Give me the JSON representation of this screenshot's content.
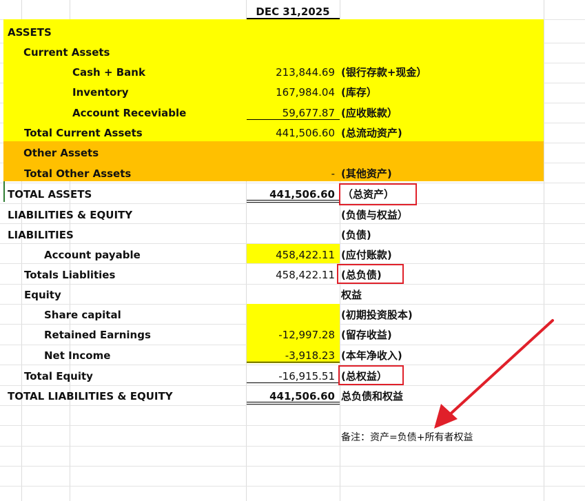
{
  "header": {
    "date": "DEC 31,2025"
  },
  "rows": {
    "assets": {
      "label": "ASSETS"
    },
    "current_assets": {
      "label": "Current Assets"
    },
    "cash_bank": {
      "label": "Cash + Bank",
      "value": "213,844.69",
      "note": "(银行存款+现金）"
    },
    "inventory": {
      "label": "Inventory",
      "value": "167,984.04",
      "note": "(库存）"
    },
    "account_receivable": {
      "label": "Account Receviable",
      "value": "59,677.87",
      "note": "(应收账款）"
    },
    "total_current_assets": {
      "label": "Total Current Assets",
      "value": "441,506.60",
      "note": "(总流动资产)"
    },
    "other_assets": {
      "label": "Other Assets"
    },
    "total_other_assets": {
      "label": "Total Other Assets",
      "value": "-",
      "note": "(其他资产)"
    },
    "total_assets": {
      "label": "TOTAL ASSETS",
      "value": "441,506.60",
      "note": "（总资产）"
    },
    "liabilities_equity": {
      "label": "LIABILITIES & EQUITY",
      "note": "(负债与权益）"
    },
    "liabilities": {
      "label": "LIABILITIES",
      "note": "(负债)"
    },
    "account_payable": {
      "label": "Account payable",
      "value": "458,422.11",
      "note": "(应付账款)"
    },
    "total_liabilities": {
      "label": "Totals Liablities",
      "value": "458,422.11",
      "note": "(总负债)"
    },
    "equity": {
      "label": "Equity",
      "note": "权益"
    },
    "share_capital": {
      "label": "Share capital",
      "note": "(初期投资股本)"
    },
    "retained_earnings": {
      "label": "Retained Earnings",
      "value": "-12,997.28",
      "note": "(留存收益)"
    },
    "net_income": {
      "label": "Net Income",
      "value": "-3,918.23",
      "note": "(本年净收入)"
    },
    "total_equity": {
      "label": "Total Equity",
      "value": "-16,915.51",
      "note": "(总权益）"
    },
    "total_liabilities_equity": {
      "label": "TOTAL LIABILITIES & EQUITY",
      "value": "441,506.60",
      "note": "总负债和权益"
    }
  },
  "remark": "备注：资产=负债+所有者权益",
  "colors": {
    "yellow": "#ffff00",
    "orange": "#ffc000",
    "red_annotation": "#e0202a"
  }
}
